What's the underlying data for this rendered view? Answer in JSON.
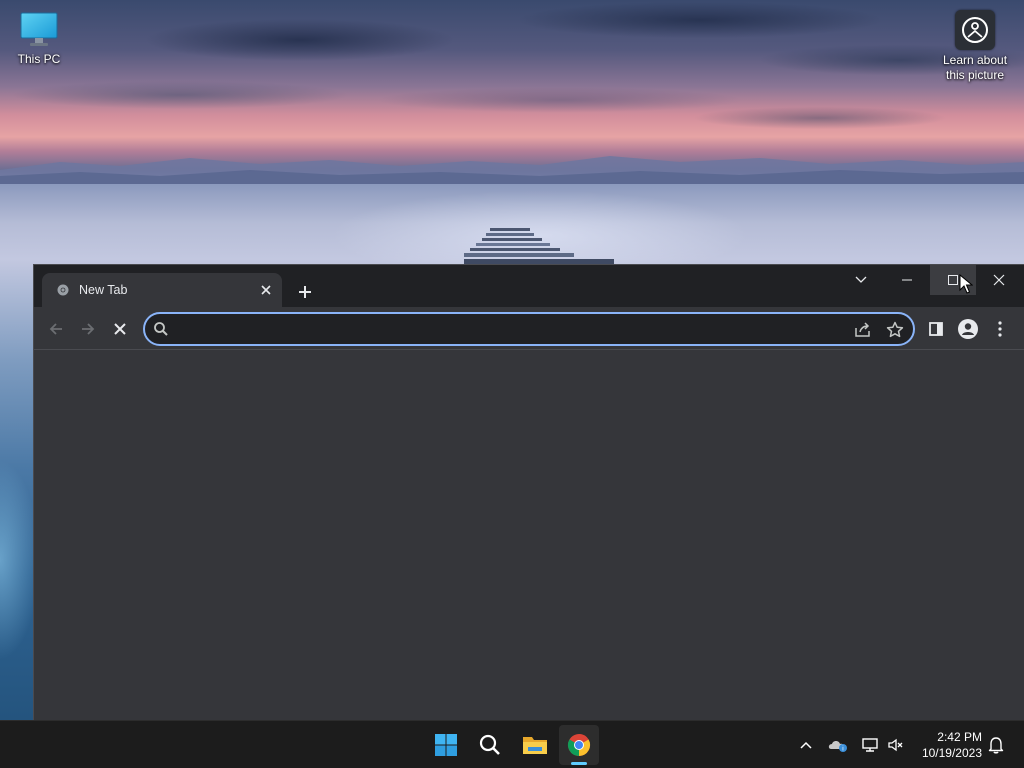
{
  "desktop": {
    "icons": [
      {
        "label": "This PC",
        "icon": "monitor-icon"
      },
      {
        "label": "Learn about this picture",
        "icon": "camera-info-icon"
      }
    ]
  },
  "browser": {
    "tab": {
      "title": "New Tab",
      "favicon": "chrome-icon"
    },
    "omnibox": {
      "value": "",
      "placeholder": ""
    },
    "colors": {
      "frame": "#202124",
      "toolbar": "#35363a",
      "focus_ring": "#8ab4f8"
    }
  },
  "taskbar": {
    "apps": [
      "windows-start-icon",
      "search-icon",
      "file-explorer-icon",
      "chrome-icon"
    ],
    "clock": {
      "time": "2:42 PM",
      "date": "10/19/2023"
    },
    "accent": "#60cdff"
  }
}
